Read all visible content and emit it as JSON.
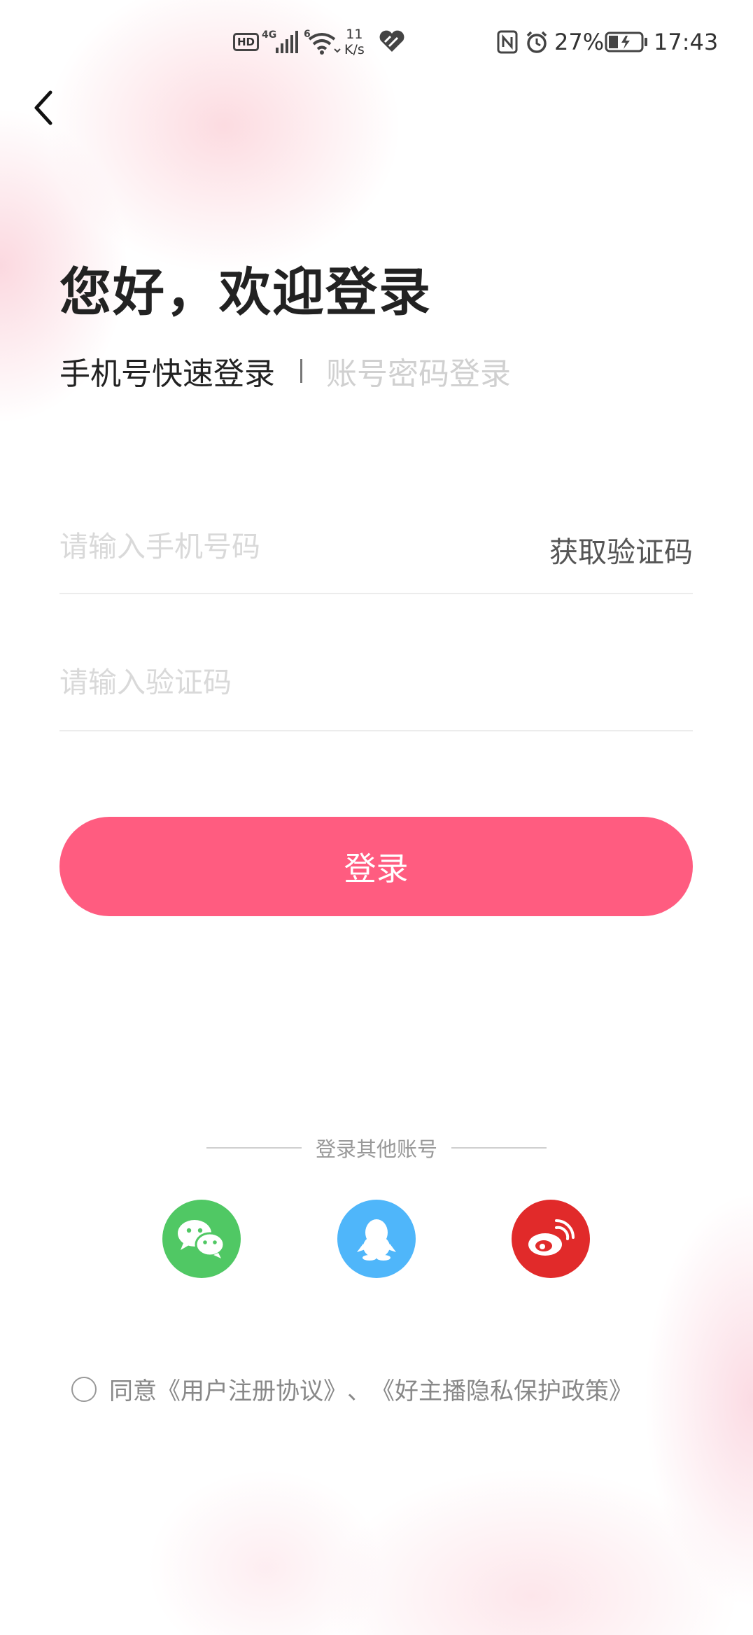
{
  "status_bar": {
    "hd": "HD",
    "network_4g": "4G",
    "network_6": "6",
    "speed_value": "11",
    "speed_unit": "K/s",
    "battery_pct": "27%",
    "time": "17:43"
  },
  "header": {
    "welcome": "您好，欢迎登录"
  },
  "tabs": {
    "active": "手机号快速登录",
    "inactive": "账号密码登录"
  },
  "form": {
    "phone_placeholder": "请输入手机号码",
    "get_code": "获取验证码",
    "code_placeholder": "请输入验证码",
    "login_label": "登录"
  },
  "other_login": {
    "title": "登录其他账号",
    "providers": [
      "wechat",
      "qq",
      "weibo"
    ]
  },
  "agreement": {
    "prefix": "同意",
    "user_agreement": "《用户注册协议》",
    "separator": "、",
    "privacy_policy": "《好主播隐私保护政策》"
  },
  "colors": {
    "primary": "#ff5c80",
    "wechat": "#50c864",
    "qq": "#4fb6fa",
    "weibo": "#e12a2a"
  }
}
